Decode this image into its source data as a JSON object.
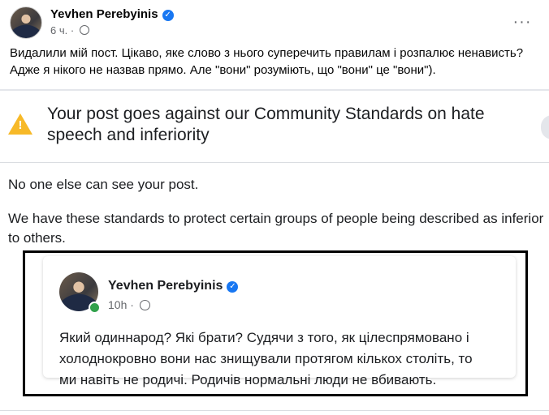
{
  "post": {
    "author": "Yevhen Perebyinis",
    "time": "6 ч.",
    "dot": "·",
    "text_lines": [
      "Видалили мій пост. Цікаво, яке слово з нього суперечить правилам і розпалює ненависть?",
      "Адже я нікого не назвав прямо. Але \"вони\" розуміють, що \"вони\" це \"вони\")."
    ],
    "more_icon": "more-horizontal-icon",
    "privacy_icon": "globe-icon"
  },
  "notice": {
    "title": "Your post goes against our Community Standards on hate speech and inferiority",
    "visibility": "No one else can see your post.",
    "explanation": "We have these standards to protect certain groups of people being described as inferior to others.",
    "icon": "warning-icon",
    "warning_color": "#f7b928"
  },
  "quoted_post": {
    "author": "Yevhen Perebyinis",
    "time": "10h",
    "dot": "·",
    "text_lines": [
      "Який одиннарод? Які брати? Судячи з того, як цілеспрямовано і",
      "холоднокровно вони нас знищували протягом кількох століть, то",
      "ми навіть не родичі. Родичів нормальні люди не вбивають."
    ],
    "online_color": "#31a24c"
  },
  "colors": {
    "verified": "#1877f2",
    "secondary_text": "#65676b"
  }
}
